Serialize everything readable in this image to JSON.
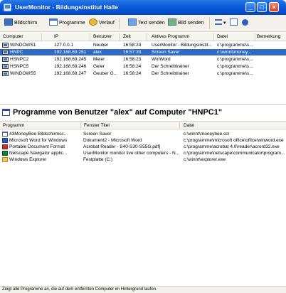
{
  "window": {
    "title": "UserMonitor - Bildungsinstitut Halle"
  },
  "toolbar": {
    "screen_label": "Bildschirm",
    "programs_label": "Programme",
    "history_label": "Verlauf",
    "send_text_label": "Text senden",
    "send_image_label": "Bild senden"
  },
  "computers": {
    "columns": [
      "Computer",
      "IP",
      "Benutzer",
      "Zeit",
      "Aktives Programm",
      "Datei",
      "Bemerkung"
    ],
    "rows": [
      {
        "computer": "WINDOWS1",
        "ip": "127.0.0.1",
        "user": "Neuber",
        "time": "16:58:24",
        "program": "UserMonitor - Bildungsinstit...",
        "file": "c:\\programme\\s...",
        "note": ""
      },
      {
        "computer": "HNPC",
        "ip": "192.168.69.251",
        "user": "alex",
        "time": "16:57:33",
        "program": "Screen Saver",
        "file": "c:\\winnt\\money...",
        "note": "",
        "selected": true
      },
      {
        "computer": "HSNPC2",
        "ip": "192.168.69.245",
        "user": "Meier",
        "time": "16:58:23",
        "program": "WinWord",
        "file": "c:\\programme\\s...",
        "note": ""
      },
      {
        "computer": "HSNPC5",
        "ip": "192.168.69.246",
        "user": "Geier",
        "time": "16:58:24",
        "program": "Der Schreibtrainer",
        "file": "c:\\programme\\s...",
        "note": ""
      },
      {
        "computer": "WINDOWS5",
        "ip": "192.168.69.247",
        "user": "Geuber G...",
        "time": "16:58:24",
        "program": "Der Schreibtrainer",
        "file": "c:\\programme\\s...",
        "note": ""
      }
    ]
  },
  "programs_section": {
    "title": "Programme von Benutzer \"alex\" auf Computer \"HNPC1\"",
    "columns": [
      "Programm",
      "Fenster Titel",
      "Datei"
    ],
    "rows": [
      {
        "program": "43MoneyBee Bildschirmsc...",
        "window": "Screen Saver",
        "file": "c:\\winnt\\moneybee.scr",
        "icon": "app-icon"
      },
      {
        "program": "Microsoft Word for Windows",
        "window": "Dokument2 - Microsoft Word",
        "file": "c:\\programme\\microsoft office\\office\\winword.exe",
        "icon": "word-icon"
      },
      {
        "program": "Portable Document Format",
        "window": "Acrobat Reader - S40-S30-S55G.pdf]",
        "file": "c:\\programme\\acrobat 4.0\\reader\\acrord32.exe",
        "icon": "pdf-icon"
      },
      {
        "program": "Netscape Navigator applic...",
        "window": "UserMonitor monitor live other computers - N...",
        "file": "c:\\programme\\netscape\\communicator\\program...",
        "icon": "netscape-icon"
      },
      {
        "program": "Windows Explorer",
        "window": "Festplatte (C:)",
        "file": "c:\\winnt\\explorer.exe",
        "icon": "folder-icon"
      }
    ]
  },
  "status": {
    "text": "Zeigt alle Programme an, die auf dem entfernten Computer im Hintergrund laufen."
  }
}
